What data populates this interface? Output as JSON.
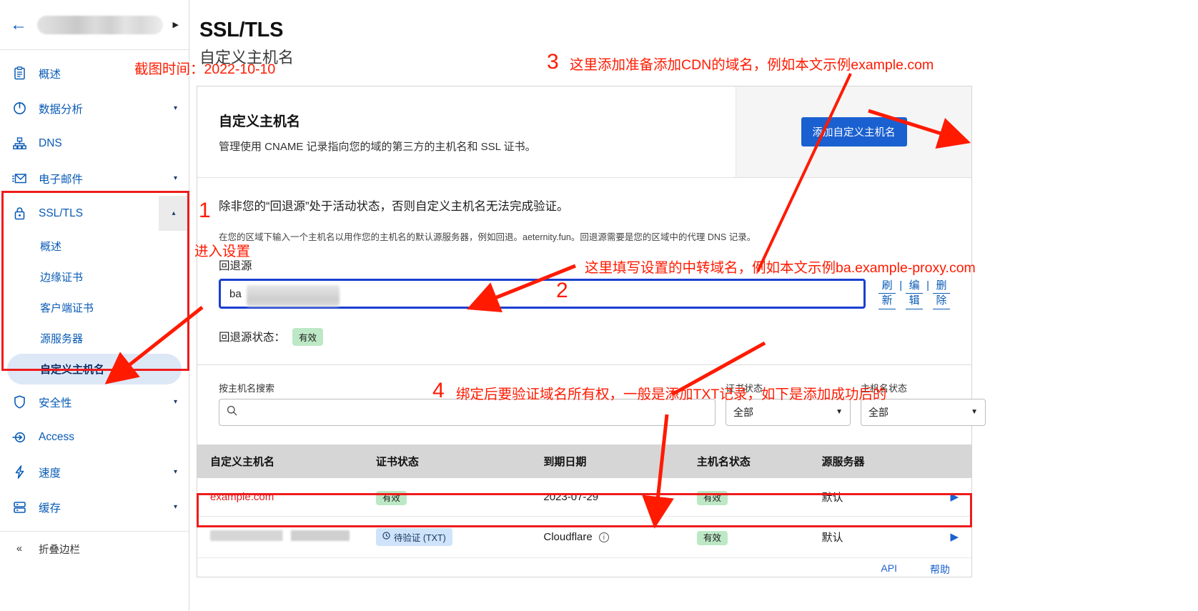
{
  "sidebar": {
    "back_icon": "back-arrow-icon",
    "zone_caret": "▶",
    "items": [
      {
        "label": "概述",
        "icon": "clipboard-icon",
        "caret": ""
      },
      {
        "label": "数据分析",
        "icon": "pie-chart-icon",
        "caret": "▾"
      },
      {
        "label": "DNS",
        "icon": "sitemap-icon",
        "caret": ""
      },
      {
        "label": "电子邮件",
        "icon": "envelope-icon",
        "caret": "▾"
      },
      {
        "label": "SSL/TLS",
        "icon": "lock-icon",
        "caret": "▴"
      }
    ],
    "sub_items": [
      {
        "label": "概述"
      },
      {
        "label": "边缘证书"
      },
      {
        "label": "客户端证书"
      },
      {
        "label": "源服务器"
      },
      {
        "label": "自定义主机名"
      }
    ],
    "items_after": [
      {
        "label": "安全性",
        "icon": "shield-icon",
        "caret": "▾"
      },
      {
        "label": "Access",
        "icon": "access-icon",
        "caret": ""
      },
      {
        "label": "速度",
        "icon": "bolt-icon",
        "caret": "▾"
      },
      {
        "label": "缓存",
        "icon": "database-icon",
        "caret": "▾"
      }
    ],
    "collapse": {
      "label": "折叠边栏",
      "icon": "double-chevron-left-icon"
    }
  },
  "page": {
    "title": "SSL/TLS",
    "subtitle": "自定义主机名"
  },
  "card": {
    "title": "自定义主机名",
    "description": "管理使用 CNAME 记录指向您的域的第三方的主机名和 SSL 证书。",
    "add_button": "添加自定义主机名",
    "warning": "除非您的“回退源”处于活动状态，否则自定义主机名无法完成验证。",
    "hint": "在您的区域下输入一个主机名以用作您的主机名的默认源服务器，例如回退。aeternity.fun。回退源需要是您的区域中的代理 DNS 记录。",
    "fallback_label": "回退源",
    "fallback_value": "ba",
    "actions": [
      {
        "line1": "刷",
        "line2": "新",
        "name": "refresh"
      },
      {
        "line1": "编",
        "line2": "辑",
        "name": "edit"
      },
      {
        "line1": "删",
        "line2": "除",
        "name": "delete"
      }
    ],
    "status_label": "回退源状态：",
    "status_badge": "有效"
  },
  "filters": {
    "search_label": "按主机名搜索",
    "search_value": "",
    "search_placeholder": "",
    "search_icon": "search-icon",
    "cert_status_label": "证书状态",
    "cert_status_value": "全部",
    "host_status_label": "主机名状态",
    "host_status_value": "全部"
  },
  "table": {
    "headers": [
      "自定义主机名",
      "证书状态",
      "到期日期",
      "主机名状态",
      "源服务器",
      ""
    ],
    "rows": [
      {
        "hostname": "example.com",
        "hostname_redacted": false,
        "cert_status": "有效",
        "cert_status_type": "ok",
        "expiry": "2023-07-29",
        "expiry_has_info": false,
        "host_status": "有效",
        "origin": "默认",
        "chevron": "▶"
      },
      {
        "hostname": "",
        "hostname_redacted": true,
        "cert_status": "待验证 (TXT)",
        "cert_status_type": "pending",
        "expiry": "Cloudflare",
        "expiry_has_info": true,
        "host_status": "有效",
        "origin": "默认",
        "chevron": "▶"
      }
    ],
    "footer_links": [
      "API",
      "帮助"
    ]
  },
  "annotations": {
    "timestamp": "截图时间：2022-10-10",
    "step1_num": "1",
    "step1_text": "进入设置",
    "step2_num": "2",
    "step2_text": "这里填写设置的中转域名，例如本文示例ba.example-proxy.com",
    "step3_num": "3",
    "step3_text": "这里添加准备添加CDN的域名，例如本文示例example.com",
    "step4_num": "4",
    "step4_text": "绑定后要验证域名所有权，一般是添加TXT记录，如下是添加成功后的"
  },
  "colors": {
    "accent_blue": "#1a60d0",
    "link_blue": "#0a5bb5",
    "annotation_red": "#ff1a00",
    "ok_green": "#bde8c5",
    "pending_blue": "#cfe4fb"
  }
}
